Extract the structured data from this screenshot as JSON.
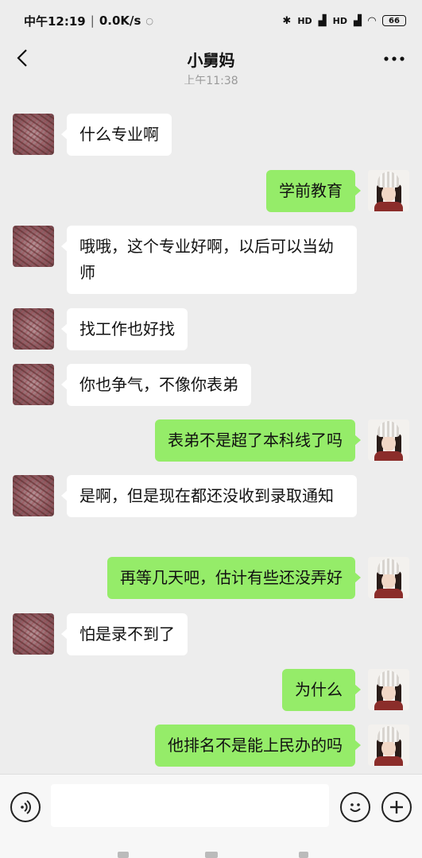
{
  "status_bar": {
    "time": "中午12:19",
    "net_speed": "0.0K/s",
    "battery": "66",
    "hd1": "HD",
    "hd2": "HD"
  },
  "header": {
    "title": "小舅妈"
  },
  "timestamp": "上午11:38",
  "messages": [
    {
      "side": "other",
      "text": "什么专业啊"
    },
    {
      "side": "self",
      "text": "学前教育"
    },
    {
      "side": "other",
      "text": "哦哦，这个专业好啊，以后可以当幼师"
    },
    {
      "side": "other",
      "text": "找工作也好找"
    },
    {
      "side": "other",
      "text": "你也争气，不像你表弟"
    },
    {
      "side": "self",
      "text": "表弟不是超了本科线了吗"
    },
    {
      "side": "other",
      "text": "是啊，但是现在都还没收到录取通知"
    },
    {
      "side": "self",
      "text": "再等几天吧，估计有些还没弄好"
    },
    {
      "side": "other",
      "text": "怕是录不到了"
    },
    {
      "side": "self",
      "text": "为什么"
    },
    {
      "side": "self",
      "text": "他排名不是能上民办的吗"
    }
  ],
  "input": {
    "value": "",
    "placeholder": ""
  },
  "icons": {
    "back": "back-arrow-icon",
    "more": "more-dots-icon",
    "voice": "voice-icon",
    "emoji": "emoji-icon",
    "plus": "plus-icon"
  },
  "colors": {
    "background": "#ededed",
    "self_bubble": "#95ec69",
    "other_bubble": "#ffffff"
  }
}
